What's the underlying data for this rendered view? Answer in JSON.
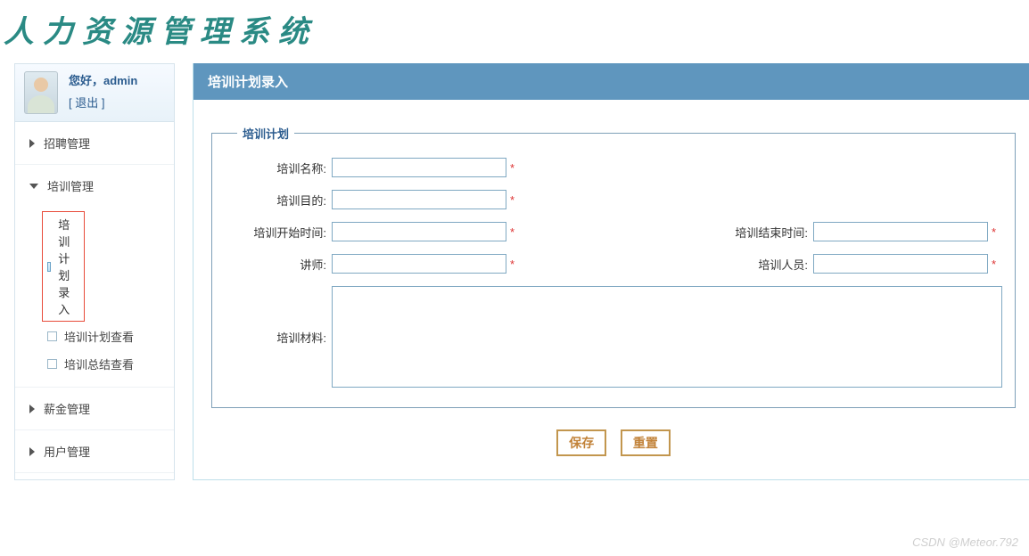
{
  "app": {
    "title": "人力资源管理系统"
  },
  "user": {
    "greeting": "您好，admin",
    "logout": "[ 退出 ]"
  },
  "nav": {
    "groups": [
      {
        "label": "招聘管理",
        "expanded": false
      },
      {
        "label": "培训管理",
        "expanded": true,
        "items": [
          {
            "label": "培训计划录入",
            "active": true
          },
          {
            "label": "培训计划查看",
            "active": false
          },
          {
            "label": "培训总结查看",
            "active": false
          }
        ]
      },
      {
        "label": "薪金管理",
        "expanded": false
      },
      {
        "label": "用户管理",
        "expanded": false
      }
    ]
  },
  "panel": {
    "title": "培训计划录入",
    "fieldset_legend": "培训计划",
    "fields": {
      "name_label": "培训名称:",
      "purpose_label": "培训目的:",
      "start_label": "培训开始时间:",
      "end_label": "培训结束时间:",
      "lecturer_label": "讲师:",
      "trainees_label": "培训人员:",
      "material_label": "培训材料:",
      "required_mark": "*"
    },
    "buttons": {
      "save": "保存",
      "reset": "重置"
    }
  },
  "watermark": "CSDN @Meteor.792"
}
